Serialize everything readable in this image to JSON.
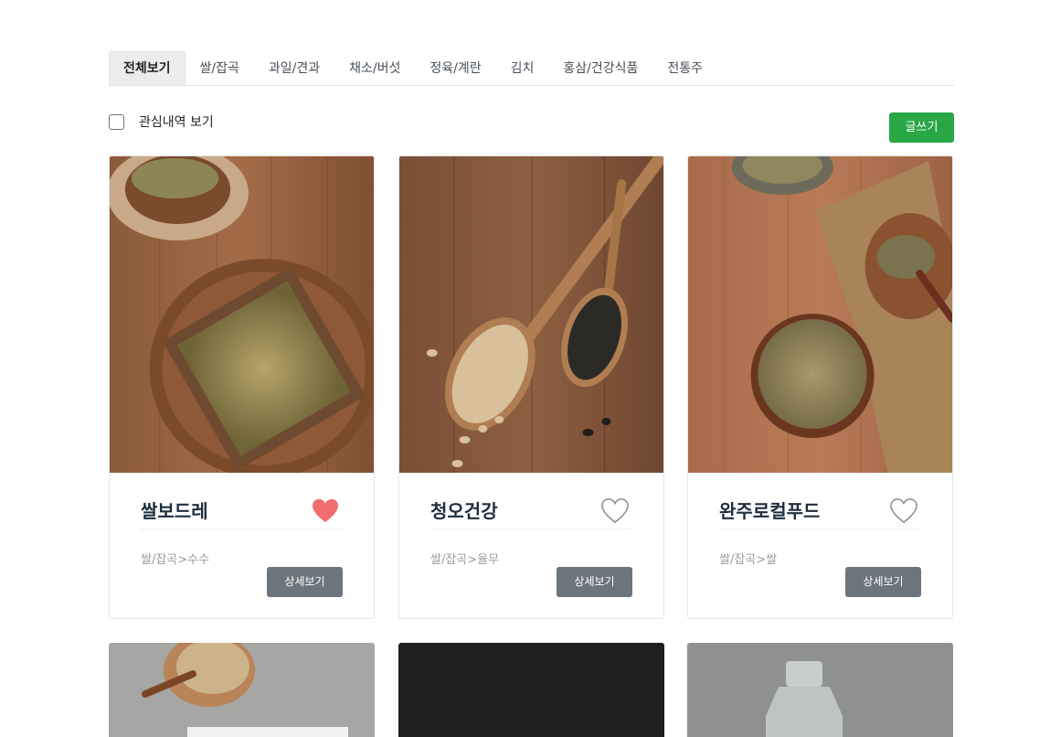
{
  "tabs": [
    {
      "label": "전체보기",
      "active": true
    },
    {
      "label": "쌀/잡곡"
    },
    {
      "label": "과일/견과"
    },
    {
      "label": "채소/버섯"
    },
    {
      "label": "정육/계란"
    },
    {
      "label": "김치"
    },
    {
      "label": "홍삼/건강식품"
    },
    {
      "label": "전통주"
    }
  ],
  "filter": {
    "watch_label": "관심내역 보기",
    "checked": false
  },
  "write_button": "글쓰기",
  "accent_color": "#28a745",
  "products": [
    {
      "name": "쌀보드레",
      "category": "쌀/잡곡>수수",
      "liked": true,
      "detail_label": "상세보기",
      "image": "millet-in-wooden-box"
    },
    {
      "name": "청오건강",
      "category": "쌀/잡곡>율무",
      "liked": false,
      "detail_label": "상세보기",
      "image": "beans-on-wooden-spoons"
    },
    {
      "name": "완주로컬푸드",
      "category": "쌀/잡곡>쌀",
      "liked": false,
      "detail_label": "상세보기",
      "image": "grain-in-wooden-bowl"
    }
  ],
  "next_row_images": [
    "sesame-bowl-on-gray",
    "dark-surface",
    "glass-bottle-on-stone"
  ]
}
